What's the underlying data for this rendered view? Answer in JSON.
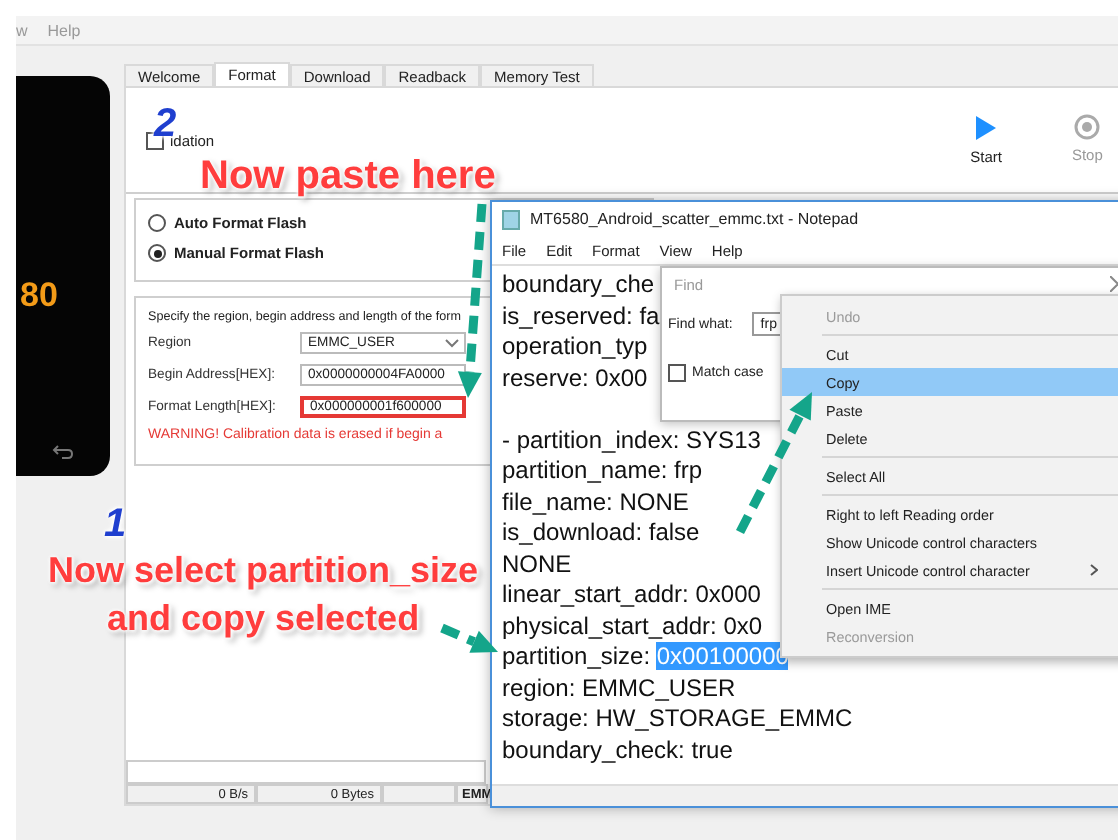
{
  "app_window": {
    "menu": [
      "w",
      "Help"
    ],
    "phone": {
      "display": "80"
    },
    "tabs": [
      {
        "label": "Welcome",
        "selected": false
      },
      {
        "label": "Format",
        "selected": true
      },
      {
        "label": "Download",
        "selected": false
      },
      {
        "label": "Readback",
        "selected": false
      },
      {
        "label": "Memory Test",
        "selected": false
      }
    ],
    "validation_checkbox": {
      "label": "idation",
      "checked": false
    },
    "toolbar": [
      {
        "kind": "start",
        "label": "Start",
        "disabled": false
      },
      {
        "kind": "stop",
        "label": "Stop",
        "disabled": true
      }
    ],
    "format_modes": [
      {
        "label": "Auto Format Flash",
        "selected": false
      },
      {
        "label": "Manual Format Flash",
        "selected": true
      }
    ],
    "region_group": {
      "description": "Specify the region, begin address and length of the form",
      "fields": [
        {
          "kind": "dropdown",
          "label": "Region",
          "value": "EMMC_USER",
          "highlighted": false
        },
        {
          "kind": "text",
          "label": "Begin Address[HEX]:",
          "value": "0x0000000004FA0000",
          "highlighted": false
        },
        {
          "kind": "text",
          "label": "Format Length[HEX]:",
          "value": "0x000000001f600000",
          "highlighted": true
        }
      ],
      "warning": "WARNING! Calibration data is erased if begin a"
    },
    "progress": {
      "level": 0
    },
    "status_bar": [
      "0 B/s",
      "0 Bytes",
      "EMM"
    ]
  },
  "notepad": {
    "title": "MT6580_Android_scatter_emmc.txt - Notepad",
    "menu": [
      "File",
      "Edit",
      "Format",
      "View",
      "Help"
    ],
    "lines": [
      {
        "kind": "text",
        "text": "boundary_che"
      },
      {
        "kind": "text",
        "text": "is_reserved: fa"
      },
      {
        "kind": "text",
        "text": "operation_typ"
      },
      {
        "kind": "text",
        "text": "reserve: 0x00"
      },
      {
        "kind": "blank"
      },
      {
        "kind": "text",
        "text": "- partition_index: SYS13"
      },
      {
        "kind": "text",
        "text": "partition_name: frp"
      },
      {
        "kind": "text",
        "text": "file_name: NONE"
      },
      {
        "kind": "text",
        "text": "is_download: false"
      },
      {
        "kind": "text",
        "text": "NONE"
      },
      {
        "kind": "text",
        "text": "linear_start_addr: 0x000"
      },
      {
        "kind": "text",
        "text": "physical_start_addr: 0x0"
      },
      {
        "kind": "text",
        "text": "partition_size: ",
        "selection": "0x00100000"
      },
      {
        "kind": "text",
        "text": "region: EMMC_USER"
      },
      {
        "kind": "text",
        "text": "storage: HW_STORAGE_EMMC"
      },
      {
        "kind": "text",
        "text": "boundary_check: true"
      }
    ]
  },
  "find_dialog": {
    "title": "Find",
    "find_what_label": "Find what:",
    "value": "frp",
    "match_case": {
      "label": "Match case",
      "checked": false
    }
  },
  "context_menu": {
    "items": [
      {
        "kind": "item",
        "label": "Undo",
        "disabled": true,
        "selected": false,
        "submenu": false
      },
      {
        "kind": "separator"
      },
      {
        "kind": "item",
        "label": "Cut",
        "disabled": false,
        "selected": false,
        "submenu": false
      },
      {
        "kind": "item",
        "label": "Copy",
        "disabled": false,
        "selected": true,
        "submenu": false
      },
      {
        "kind": "item",
        "label": "Paste",
        "disabled": false,
        "selected": false,
        "submenu": false
      },
      {
        "kind": "item",
        "label": "Delete",
        "disabled": false,
        "selected": false,
        "submenu": false
      },
      {
        "kind": "separator"
      },
      {
        "kind": "item",
        "label": "Select All",
        "disabled": false,
        "selected": false,
        "submenu": false
      },
      {
        "kind": "separator"
      },
      {
        "kind": "item",
        "label": "Right to left Reading order",
        "disabled": false,
        "selected": false,
        "submenu": false
      },
      {
        "kind": "item",
        "label": "Show Unicode control characters",
        "disabled": false,
        "selected": false,
        "submenu": false
      },
      {
        "kind": "item",
        "label": "Insert Unicode control character",
        "disabled": false,
        "selected": false,
        "submenu": true
      },
      {
        "kind": "separator"
      },
      {
        "kind": "item",
        "label": "Open IME",
        "disabled": false,
        "selected": false,
        "submenu": false
      },
      {
        "kind": "item",
        "label": "Reconversion",
        "disabled": true,
        "selected": false,
        "submenu": false
      }
    ]
  },
  "annotations": {
    "paste_step": "2",
    "paste_caption": [
      "Now paste here"
    ],
    "copy_step": "1",
    "copy_caption": [
      "Now select partition_size",
      "and copy selected"
    ]
  }
}
